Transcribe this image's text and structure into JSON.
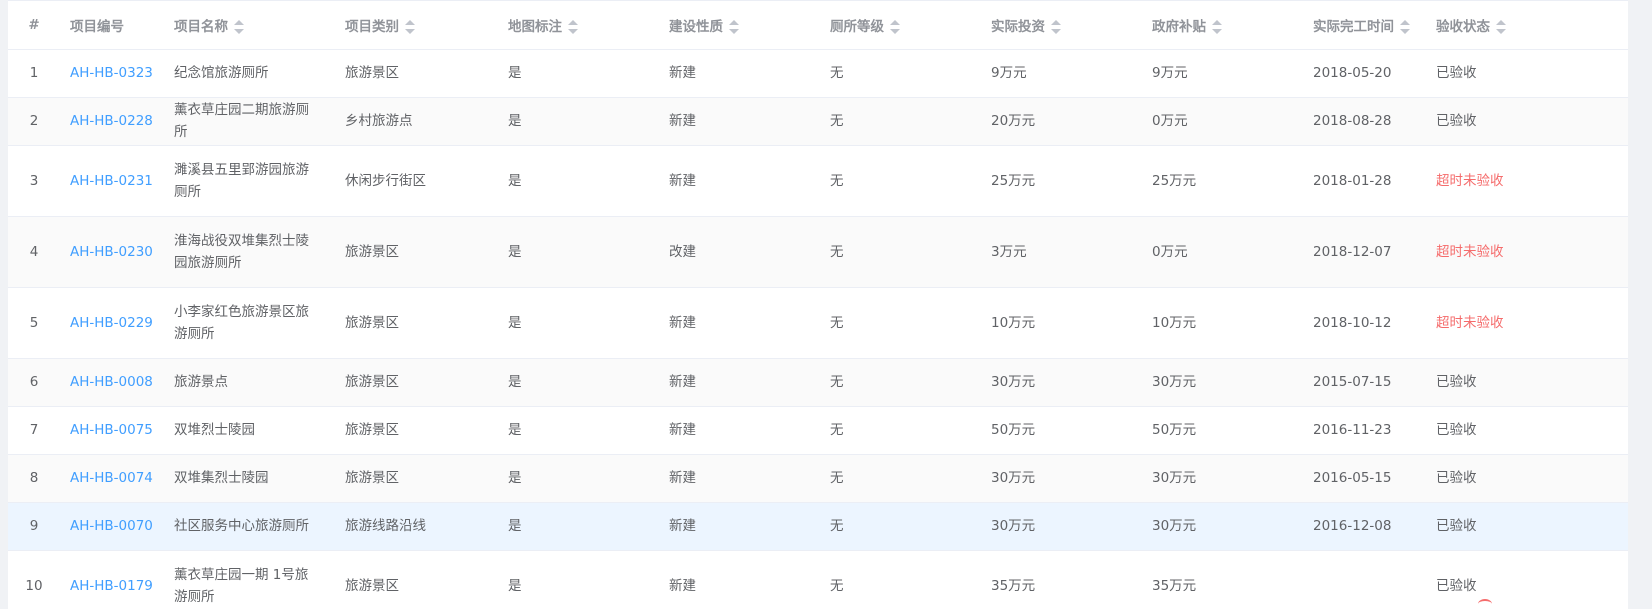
{
  "columns": {
    "index": "#",
    "code": "项目编号",
    "name": "项目名称",
    "category": "项目类别",
    "map_mark": "地图标注",
    "build_type": "建设性质",
    "toilet_level": "厕所等级",
    "investment": "实际投资",
    "subsidy": "政府补贴",
    "complete_time": "实际完工时间",
    "status": "验收状态"
  },
  "rows": [
    {
      "index": "1",
      "code": "AH-HB-0323",
      "name": "纪念馆旅游厕所",
      "category": "旅游景区",
      "map_mark": "是",
      "build_type": "新建",
      "toilet_level": "无",
      "investment": "9万元",
      "subsidy": "9万元",
      "complete_time": "2018-05-20",
      "status": "已验收"
    },
    {
      "index": "2",
      "code": "AH-HB-0228",
      "name": "薰衣草庄园二期旅游厕所",
      "category": "乡村旅游点",
      "map_mark": "是",
      "build_type": "新建",
      "toilet_level": "无",
      "investment": "20万元",
      "subsidy": "0万元",
      "complete_time": "2018-08-28",
      "status": "已验收"
    },
    {
      "index": "3",
      "code": "AH-HB-0231",
      "name": "濉溪县五里郢游园旅游厕所",
      "category": "休闲步行街区",
      "map_mark": "是",
      "build_type": "新建",
      "toilet_level": "无",
      "investment": "25万元",
      "subsidy": "25万元",
      "complete_time": "2018-01-28",
      "status": "超时未验收"
    },
    {
      "index": "4",
      "code": "AH-HB-0230",
      "name": "淮海战役双堆集烈士陵园旅游厕所",
      "category": "旅游景区",
      "map_mark": "是",
      "build_type": "改建",
      "toilet_level": "无",
      "investment": "3万元",
      "subsidy": "0万元",
      "complete_time": "2018-12-07",
      "status": "超时未验收"
    },
    {
      "index": "5",
      "code": "AH-HB-0229",
      "name": "小李家红色旅游景区旅游厕所",
      "category": "旅游景区",
      "map_mark": "是",
      "build_type": "新建",
      "toilet_level": "无",
      "investment": "10万元",
      "subsidy": "10万元",
      "complete_time": "2018-10-12",
      "status": "超时未验收"
    },
    {
      "index": "6",
      "code": "AH-HB-0008",
      "name": "旅游景点",
      "category": "旅游景区",
      "map_mark": "是",
      "build_type": "新建",
      "toilet_level": "无",
      "investment": "30万元",
      "subsidy": "30万元",
      "complete_time": "2015-07-15",
      "status": "已验收"
    },
    {
      "index": "7",
      "code": "AH-HB-0075",
      "name": "双堆烈士陵园",
      "category": "旅游景区",
      "map_mark": "是",
      "build_type": "新建",
      "toilet_level": "无",
      "investment": "50万元",
      "subsidy": "50万元",
      "complete_time": "2016-11-23",
      "status": "已验收"
    },
    {
      "index": "8",
      "code": "AH-HB-0074",
      "name": "双堆集烈士陵园",
      "category": "旅游景区",
      "map_mark": "是",
      "build_type": "新建",
      "toilet_level": "无",
      "investment": "30万元",
      "subsidy": "30万元",
      "complete_time": "2016-05-15",
      "status": "已验收"
    },
    {
      "index": "9",
      "code": "AH-HB-0070",
      "name": "社区服务中心旅游厕所",
      "category": "旅游线路沿线",
      "map_mark": "是",
      "build_type": "新建",
      "toilet_level": "无",
      "investment": "30万元",
      "subsidy": "30万元",
      "complete_time": "2016-12-08",
      "status": "已验收"
    },
    {
      "index": "10",
      "code": "AH-HB-0179",
      "name": "薰衣草庄园一期 1号旅游厕所",
      "category": "旅游景区",
      "map_mark": "是",
      "build_type": "新建",
      "toilet_level": "无",
      "investment": "35万元",
      "subsidy": "35万元",
      "complete_time": "",
      "status": "已验收"
    }
  ],
  "colors": {
    "link": "#409eff",
    "overdue": "#f56c6c",
    "text": "#606266",
    "header": "#909399",
    "hover_row": "#ecf5ff"
  },
  "icons": {
    "sort": "sort-caret-icon"
  }
}
